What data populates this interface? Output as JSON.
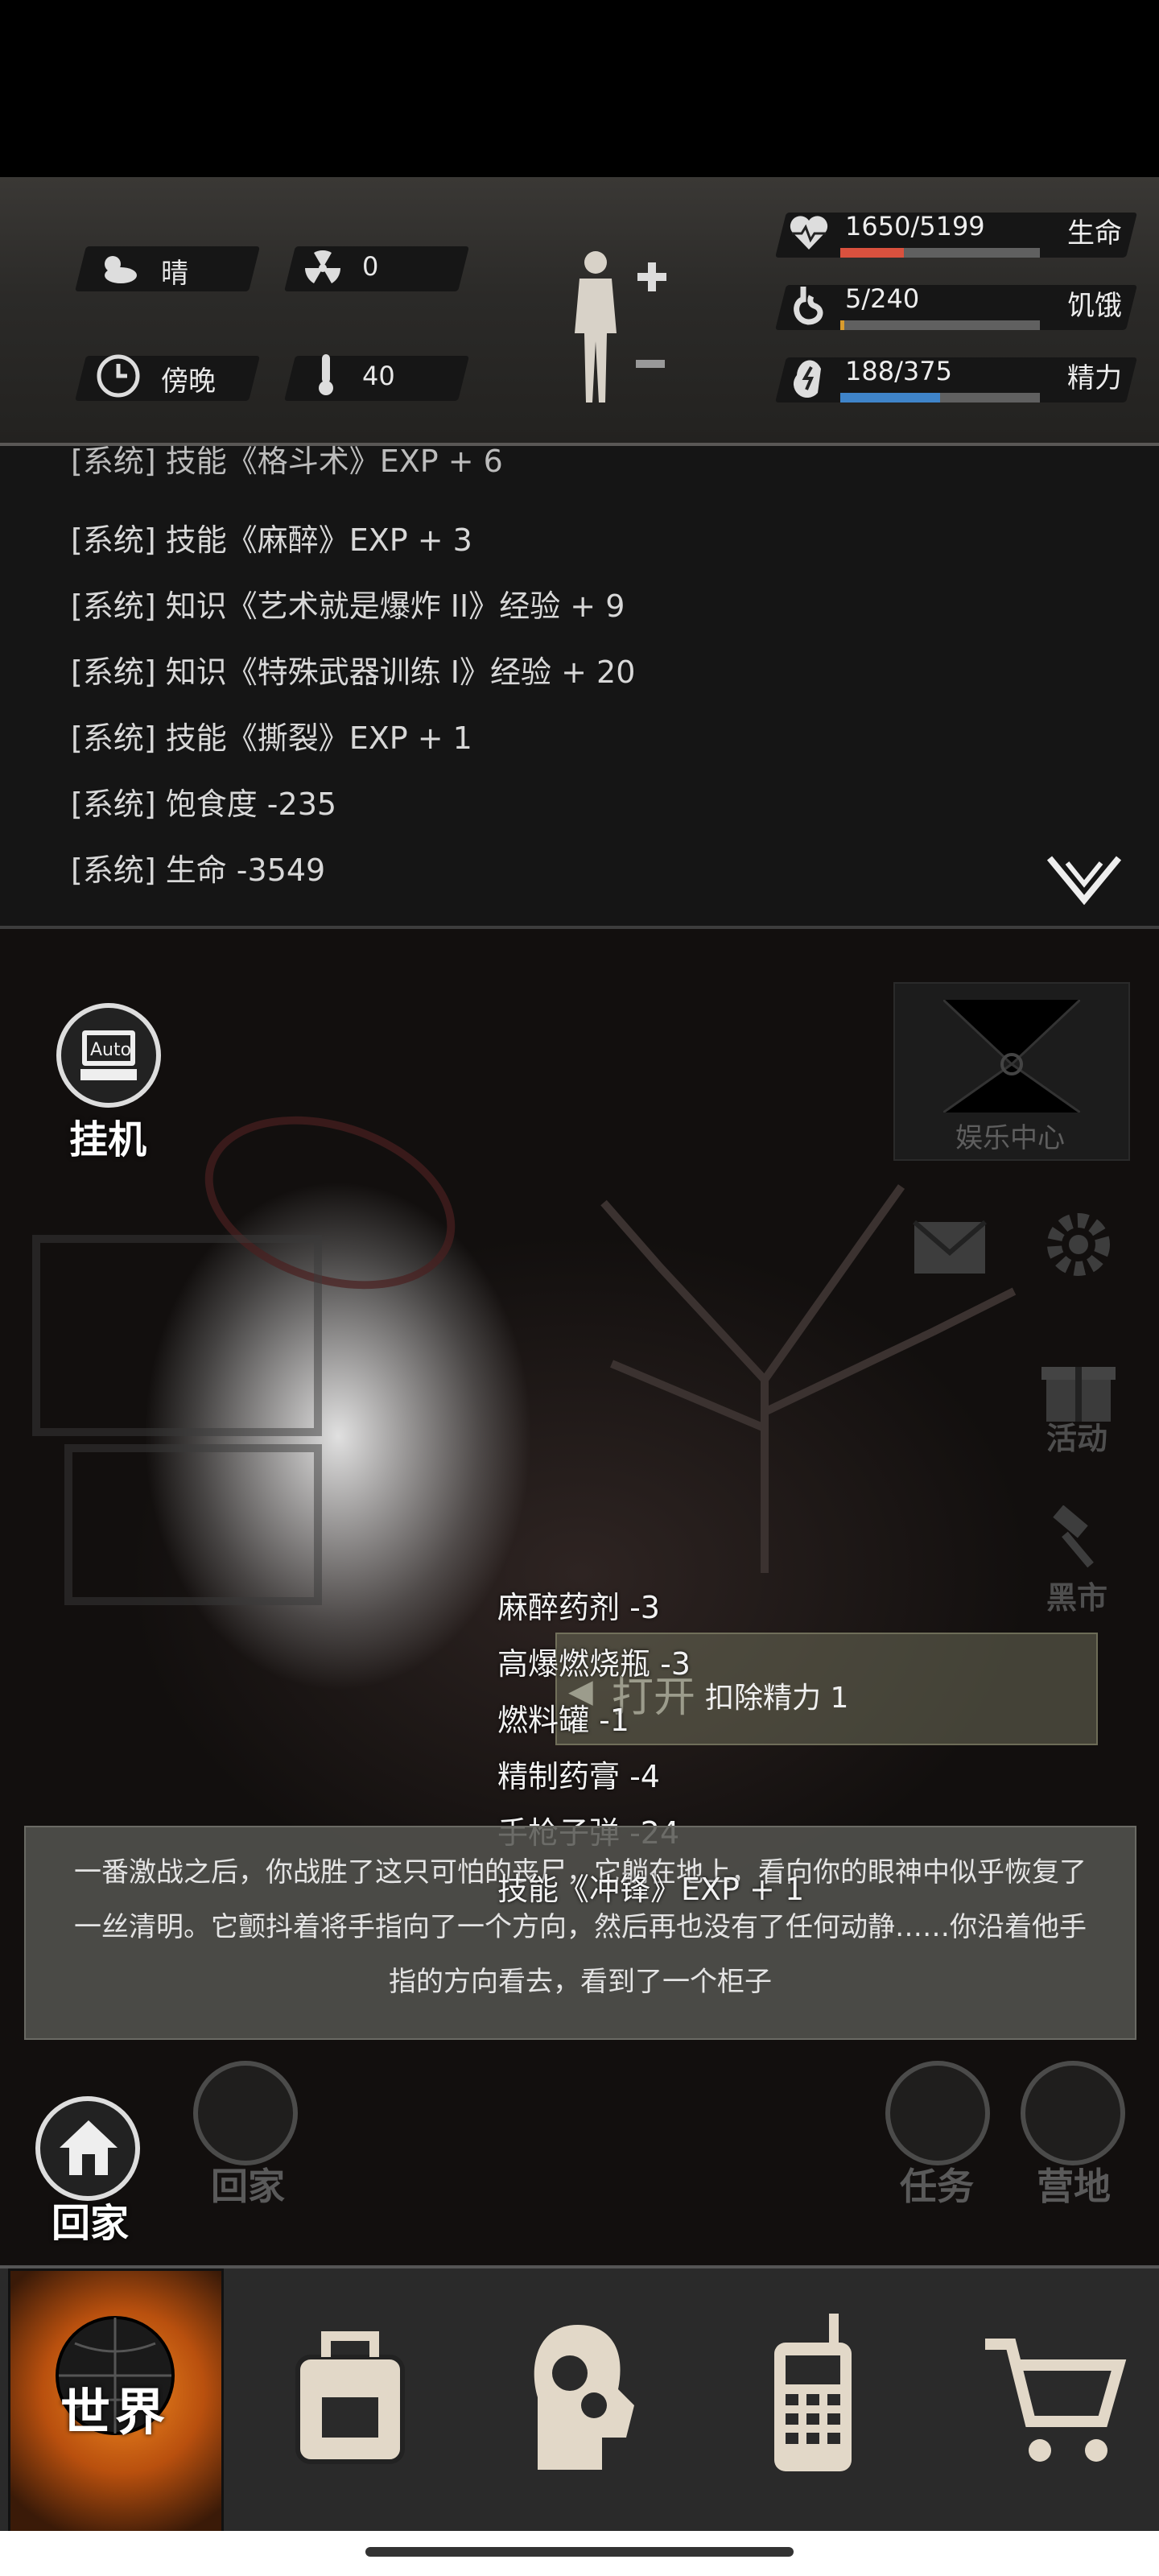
{
  "status": {
    "weather": "晴",
    "radiation": "0",
    "time_of_day": "傍晚",
    "temperature": "40",
    "stats": [
      {
        "label": "生命",
        "value": "1650/5199",
        "fraction": 0.317,
        "color": "#d9513e",
        "icon": "heart-pulse-icon"
      },
      {
        "label": "饥饿",
        "value": "5/240",
        "fraction": 0.021,
        "color": "#d89b2e",
        "icon": "stomach-icon"
      },
      {
        "label": "精力",
        "value": "188/375",
        "fraction": 0.501,
        "color": "#3f84c9",
        "icon": "energy-bolt-icon"
      }
    ]
  },
  "log": {
    "lines": [
      "[系统] 技能《格斗术》EXP + 6",
      "[系统] 技能《麻醉》EXP + 3",
      "[系统] 知识《艺术就是爆炸 II》经验 + 9",
      "[系统] 知识《特殊武器训练 I》经验 + 20",
      "[系统] 技能《撕裂》EXP + 1",
      "[系统] 饱食度 -235",
      "[系统] 生命 -3549"
    ]
  },
  "scene": {
    "auto_label": "挂机",
    "auto_icon_text": "Auto",
    "entertainment_label": "娱乐中心",
    "side_items": [
      "活动",
      "黑市"
    ],
    "popup": {
      "action": "打开",
      "cost": "扣除精力 1"
    },
    "loot": [
      "麻醉药剂 -3",
      "高爆燃烧瓶 -3",
      "燃料罐 -1",
      "精制药膏 -4",
      "手枪子弹 -24",
      "技能《冲锋》EXP + 1"
    ],
    "story": "一番激战之后，你战胜了这只可怕的丧尸，它躺在地上，看向你的眼神中似乎恢复了一丝清明。它颤抖着将手指向了一个方向，然后再也没有了任何动静……你沿着他手指的方向看去，看到了一个柜子",
    "home_label": "回家",
    "home_label_dim": "回家",
    "task_label": "任务",
    "camp_label": "营地"
  },
  "nav": {
    "world_label": "世界",
    "tabs": [
      "world",
      "backpack",
      "skills",
      "radio",
      "shop"
    ]
  }
}
